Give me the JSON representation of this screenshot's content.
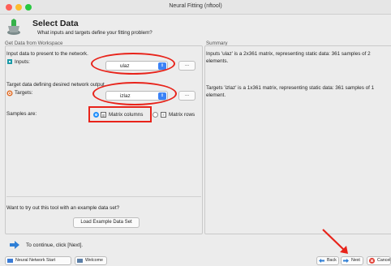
{
  "window": {
    "title": "Neural Fitting (nftool)"
  },
  "header": {
    "title": "Select Data",
    "subtitle": "What inputs and targets define your fitting problem?"
  },
  "left_panel": {
    "title": "Get Data from Workspace",
    "inputs_prompt": "Input data to present to the network.",
    "inputs_label": "Inputs:",
    "inputs_value": "ulaz",
    "targets_prompt": "Target data defining desired network output.",
    "targets_label": "Targets:",
    "targets_value": "izlaz",
    "browse_label": "...",
    "samples_label": "Samples are:",
    "matrix_columns": "Matrix columns",
    "matrix_rows": "Matrix rows",
    "example_prompt": "Want to try out this tool with an example data set?",
    "load_example": "Load Example Data Set"
  },
  "right_panel": {
    "title": "Summary",
    "inputs_summary": "Inputs 'ulaz' is a 2x361 matrix, representing static data: 361 samples of 2 elements.",
    "targets_summary": "Targets 'izlaz' is a 1x361 matrix, representing static data: 361 samples of 1 element."
  },
  "footer": {
    "continue_text": "To continue, click [Next].",
    "neural_start": "Neural Network Start",
    "welcome": "Welcome",
    "back": "Back",
    "next": "Next",
    "cancel": "Cancel"
  },
  "colors": {
    "highlight": "#e8231a",
    "accent": "#1d8efb"
  }
}
